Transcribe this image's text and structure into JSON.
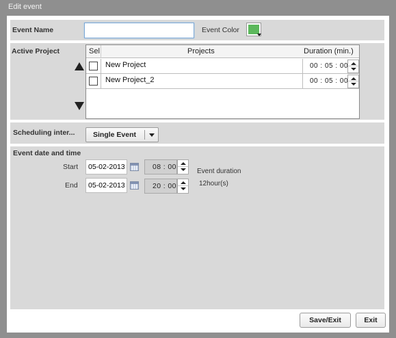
{
  "window": {
    "title": "Edit event"
  },
  "event_name": {
    "label": "Event Name",
    "value": "",
    "color_label": "Event Color",
    "color": "#5cb85c"
  },
  "active_project": {
    "label": "Active Project",
    "columns": {
      "select": "Sel",
      "projects": "Projects",
      "duration": "Duration (min.)"
    },
    "rows": [
      {
        "name": "New Project",
        "checked": false,
        "duration": "00 : 05 : 00"
      },
      {
        "name": "New Project_2",
        "checked": false,
        "duration": "00 : 05 : 00"
      }
    ],
    "move_up_icon": "triangle-up-icon",
    "move_down_icon": "triangle-down-icon"
  },
  "scheduling": {
    "label": "Scheduling inter...",
    "selected": "Single Event"
  },
  "event_datetime": {
    "section_label": "Event date and time",
    "start": {
      "label": "Start",
      "date": "05-02-2013",
      "time": "08 : 00"
    },
    "end": {
      "label": "End",
      "date": "05-02-2013",
      "time": "20 : 00"
    },
    "duration_label": "Event duration",
    "duration_value": "12hour(s)"
  },
  "buttons": {
    "save_exit": "Save/Exit",
    "exit": "Exit"
  }
}
